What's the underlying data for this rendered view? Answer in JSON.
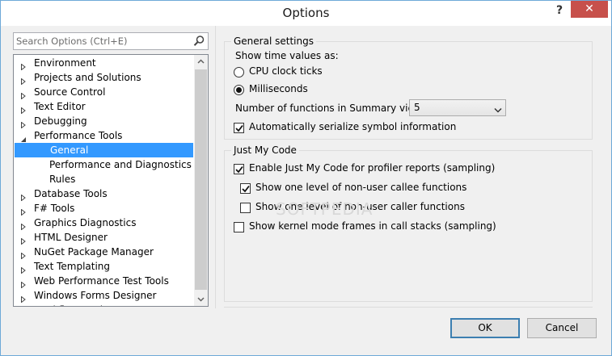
{
  "window": {
    "title": "Options",
    "help_glyph": "?",
    "close_glyph": "✕"
  },
  "search": {
    "placeholder": "Search Options (Ctrl+E)"
  },
  "tree": {
    "items": [
      {
        "label": "Environment",
        "state": "collapsed"
      },
      {
        "label": "Projects and Solutions",
        "state": "collapsed"
      },
      {
        "label": "Source Control",
        "state": "collapsed"
      },
      {
        "label": "Text Editor",
        "state": "collapsed"
      },
      {
        "label": "Debugging",
        "state": "collapsed"
      },
      {
        "label": "Performance Tools",
        "state": "expanded"
      },
      {
        "label": "General",
        "state": "child-selected"
      },
      {
        "label": "Performance and Diagnostics",
        "state": "child"
      },
      {
        "label": "Rules",
        "state": "child"
      },
      {
        "label": "Database Tools",
        "state": "collapsed"
      },
      {
        "label": "F# Tools",
        "state": "collapsed"
      },
      {
        "label": "Graphics Diagnostics",
        "state": "collapsed"
      },
      {
        "label": "HTML Designer",
        "state": "collapsed"
      },
      {
        "label": "NuGet Package Manager",
        "state": "collapsed"
      },
      {
        "label": "Text Templating",
        "state": "collapsed"
      },
      {
        "label": "Web Performance Test Tools",
        "state": "collapsed"
      },
      {
        "label": "Windows Forms Designer",
        "state": "collapsed"
      },
      {
        "label": "Workflow Designer",
        "state": "collapsed"
      }
    ]
  },
  "general_settings": {
    "title": "General settings",
    "time_label": "Show time values as:",
    "cpu_ticks": "CPU clock ticks",
    "milliseconds": "Milliseconds",
    "selected_time": "milliseconds",
    "num_functions_label": "Number of functions in Summary view:",
    "num_functions_value": "5",
    "auto_serialize": "Automatically serialize symbol information",
    "auto_serialize_checked": true
  },
  "just_my_code": {
    "title": "Just My Code",
    "enable": "Enable Just My Code for profiler reports (sampling)",
    "enable_checked": true,
    "callee": "Show one level of non-user callee functions",
    "callee_checked": true,
    "caller": "Show one level of non-user caller functions",
    "caller_checked": false,
    "kernel": "Show kernel mode frames in call stacks (sampling)",
    "kernel_checked": false
  },
  "watermark": "SOFTPEDIA",
  "buttons": {
    "ok": "OK",
    "cancel": "Cancel"
  }
}
